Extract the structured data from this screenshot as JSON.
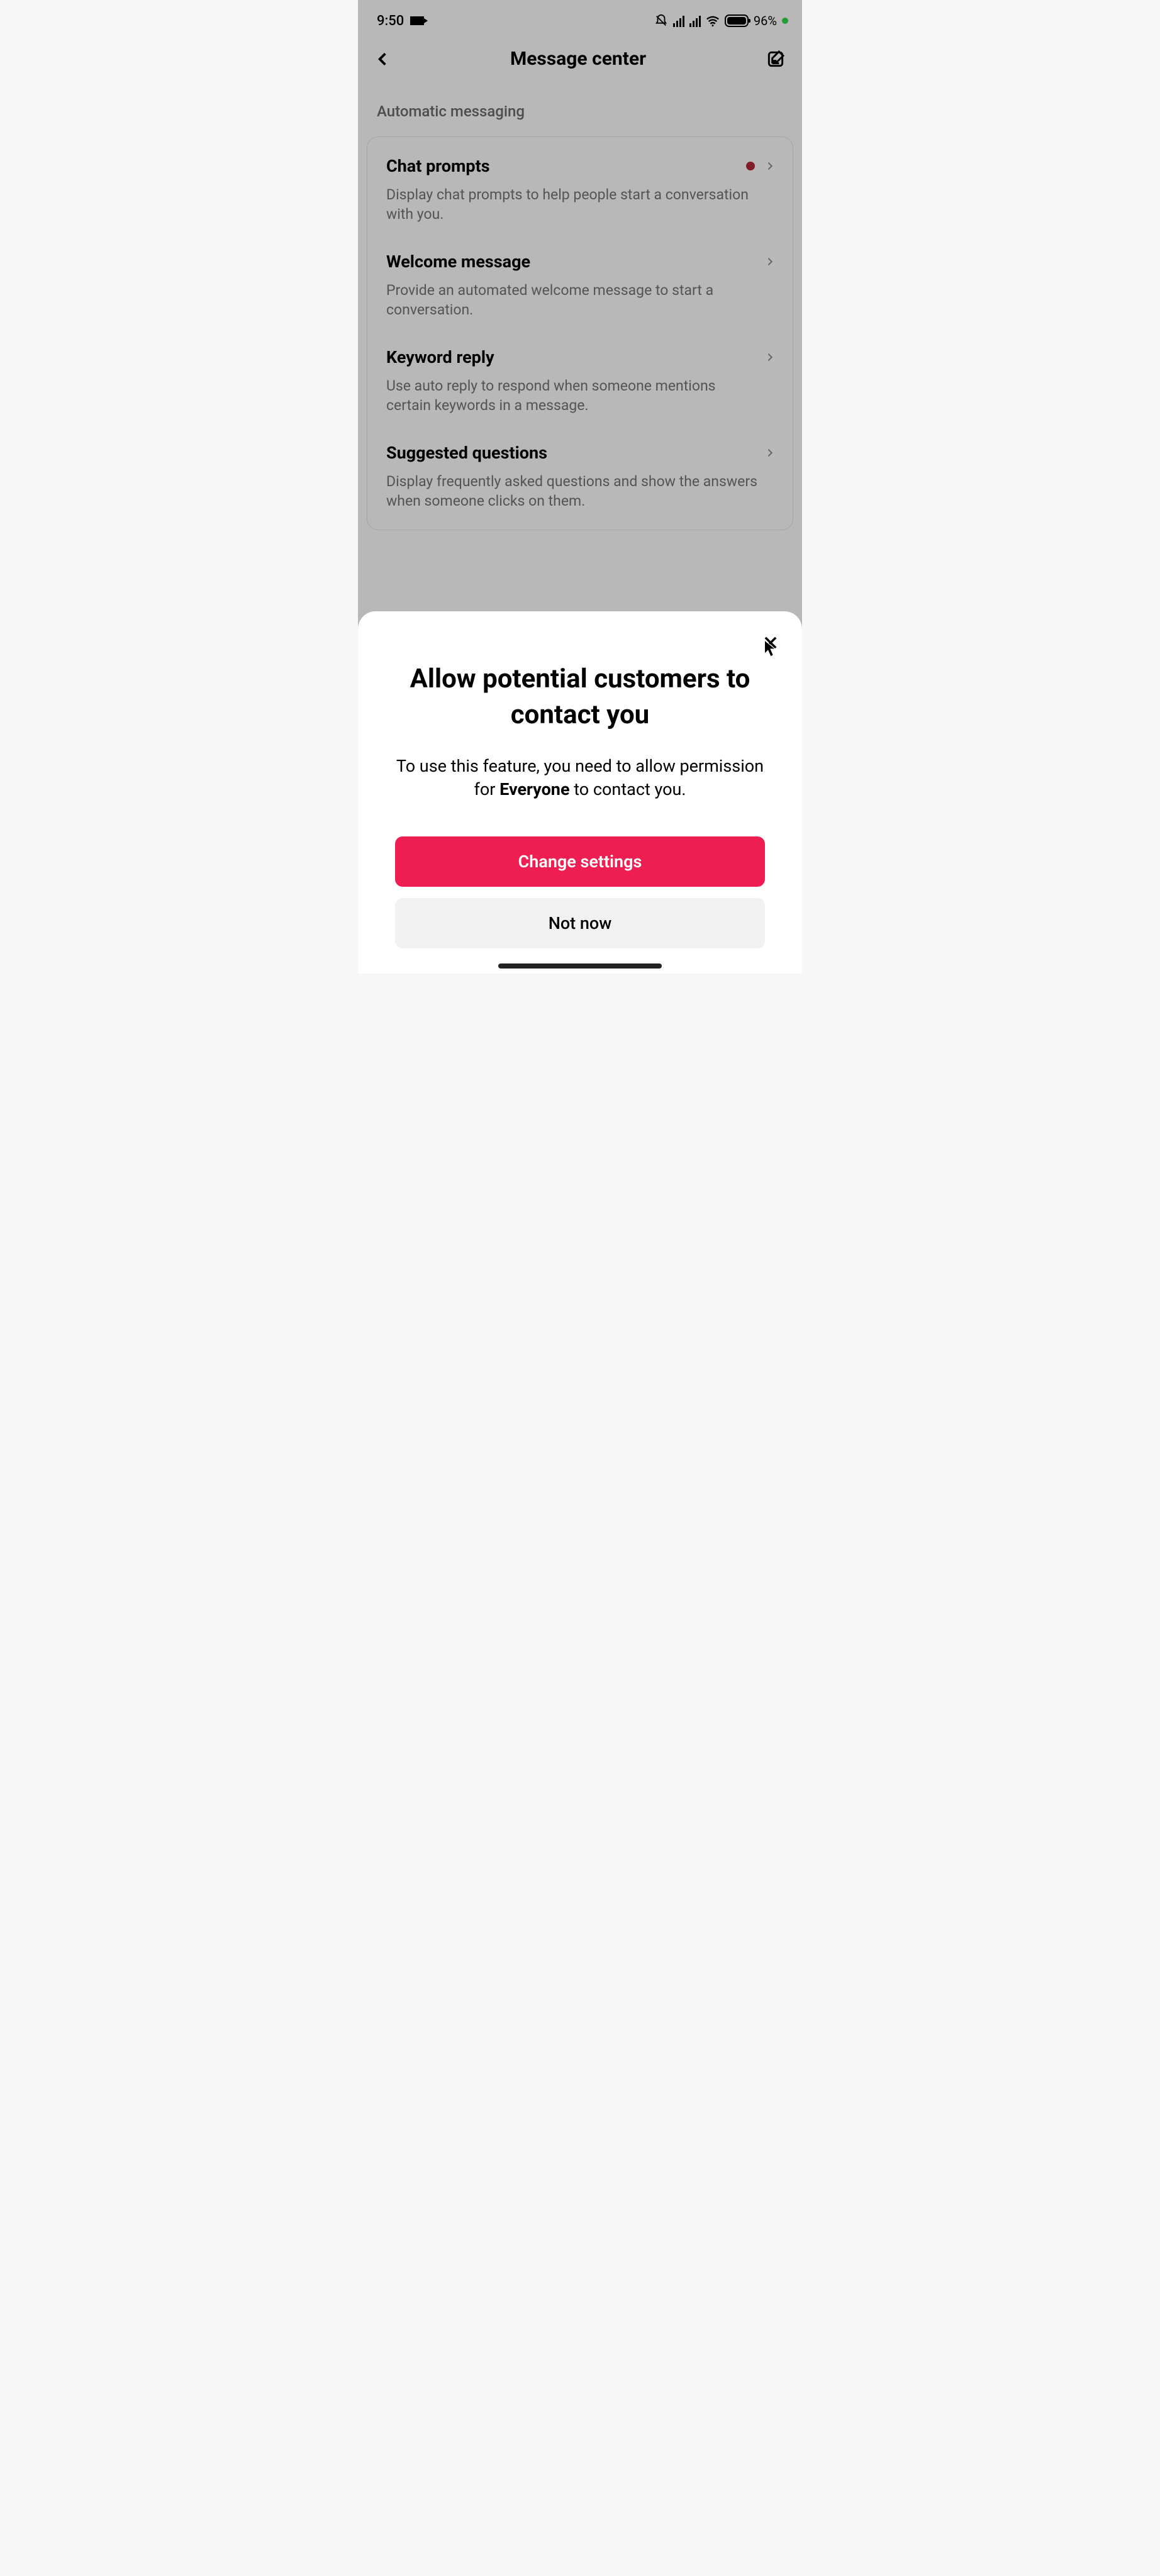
{
  "status": {
    "time": "9:50",
    "battery_pct": "96%"
  },
  "header": {
    "title": "Message center"
  },
  "section": {
    "label": "Automatic messaging",
    "items": [
      {
        "title": "Chat prompts",
        "desc": "Display chat prompts to help people start a conversation with you.",
        "dot": true
      },
      {
        "title": "Welcome message",
        "desc": "Provide an automated welcome message to start a conversation.",
        "dot": false
      },
      {
        "title": "Keyword reply",
        "desc": "Use auto reply to respond when someone mentions certain keywords in a message.",
        "dot": false
      },
      {
        "title": "Suggested questions",
        "desc": "Display frequently asked questions and show the answers when someone clicks on them.",
        "dot": false
      }
    ]
  },
  "sheet": {
    "title": "Allow potential customers to contact you",
    "desc_pre": "To use this feature, you need to allow permission for ",
    "desc_bold": "Everyone",
    "desc_post": " to contact you.",
    "primary": "Change settings",
    "secondary": "Not now"
  }
}
